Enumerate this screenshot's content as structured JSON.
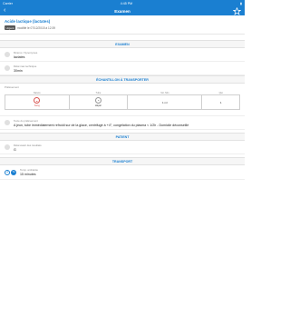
{
  "status": {
    "carrier": "Carrier",
    "time": "4:45 PM",
    "battery": "▮"
  },
  "nav": {
    "back": "‹",
    "title": "Examen"
  },
  "header": {
    "title": "Acide lactique (lactates)",
    "badge": "Urgent",
    "updated": "modifié le 07/12/2015 à 12:39"
  },
  "sections": {
    "examen": "EXAMEN",
    "echantillon": "ÉCHANTILLON À TRANSPORTER",
    "patient": "PATIENT",
    "transport": "TRANSPORT"
  },
  "fields": {
    "libelle": {
      "label": "Mnémo / Synonymes",
      "value": "lactates"
    },
    "delai": {
      "label": "Délai max technique",
      "value": "30min"
    },
    "preanalytique": {
      "label": "Texte du prélèvement",
      "value": "A jeun, tube immédiatement refroidi sur de la glace, centrifugé à +4°, congélation du plasma < 1/2h - Domicile déconseillé"
    },
    "patient": {
      "label": "Délai avant des résultats",
      "value": "G"
    },
    "transport": {
      "label": "Temp. ambiante",
      "value": "15 minutes"
    }
  },
  "table": {
    "title": "Prélèvement",
    "headers": [
      "Nature",
      "Tube",
      "Vol. Min",
      "Qté"
    ],
    "row": {
      "nature_label": "Sang",
      "tube_label": "Hépar",
      "vol": "1 ml",
      "qty": "1"
    }
  },
  "pills": {
    "a": "+4",
    "b": "TA"
  },
  "colors": {
    "brand": "#1a7fd1",
    "alert": "#d9534f"
  }
}
